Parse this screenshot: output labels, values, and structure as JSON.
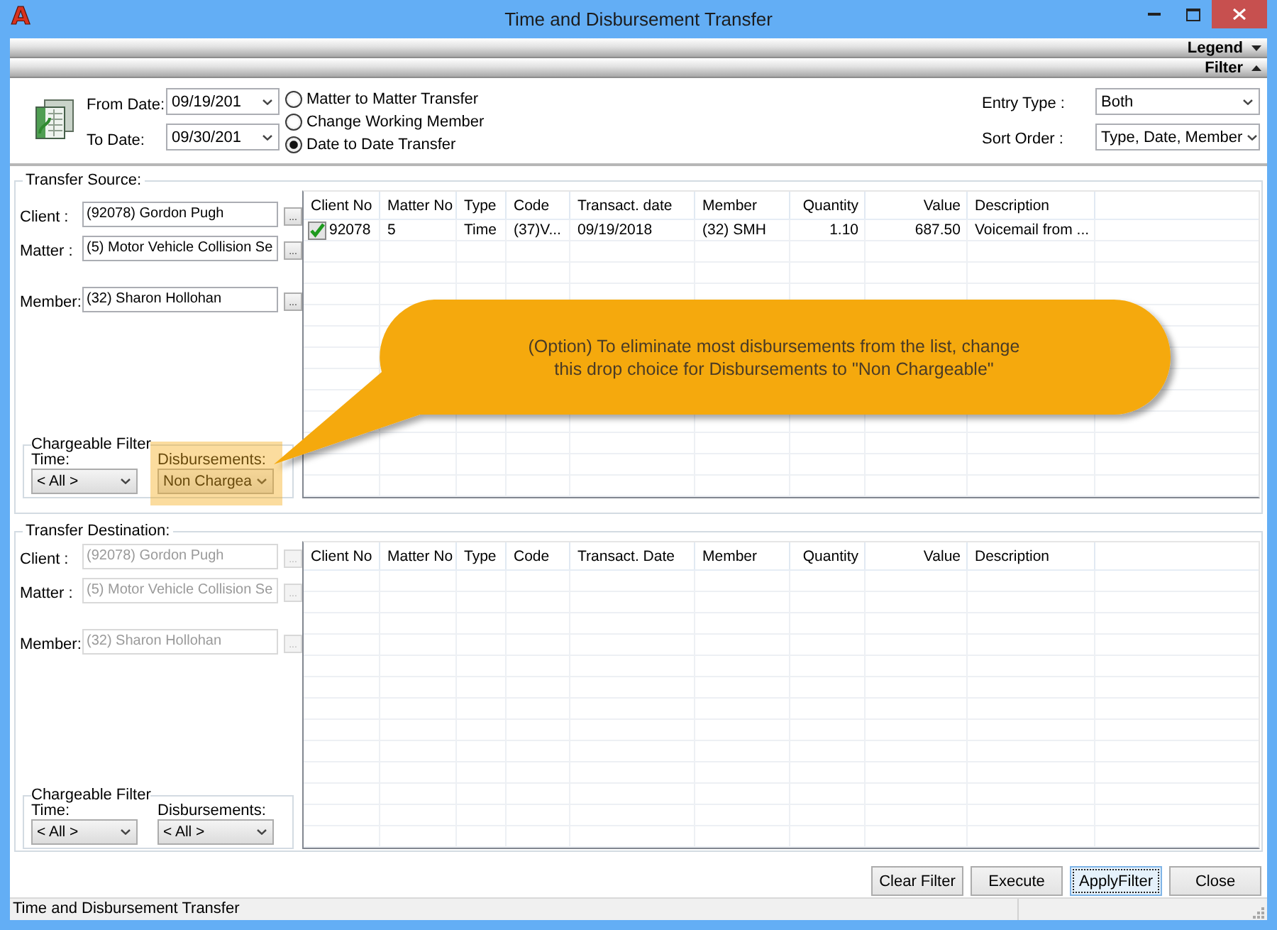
{
  "window": {
    "logo": "A",
    "title": "Time and Disbursement Transfer"
  },
  "panel_bars": [
    {
      "label": "Legend",
      "expanded": false
    },
    {
      "label": "Filter",
      "expanded": true
    }
  ],
  "filter": {
    "from_date": {
      "label": "From Date:",
      "value": "09/19/201"
    },
    "to_date": {
      "label": "To Date:",
      "value": "09/30/201"
    },
    "transfer_modes": [
      {
        "label": "Matter to Matter Transfer",
        "selected": false
      },
      {
        "label": "Change Working Member",
        "selected": false
      },
      {
        "label": "Date to Date Transfer",
        "selected": true
      }
    ],
    "entry_type": {
      "label": "Entry Type :",
      "value": "Both"
    },
    "sort_order": {
      "label": "Sort Order :",
      "value": "Type, Date, Member"
    }
  },
  "sections": [
    {
      "title": "Transfer Source:",
      "fields": [
        {
          "label": "Client :",
          "value": "(92078) Gordon Pugh",
          "button": "...",
          "disabled": false
        },
        {
          "label": "Matter :",
          "value": "(5) Motor Vehicle Collision Se",
          "button": "...",
          "disabled": false
        },
        {
          "label": "Member:",
          "value": "(32) Sharon Hollohan",
          "button": "...",
          "disabled": false
        }
      ],
      "chargeable_filter": {
        "title": "Chargeable Filter",
        "time": {
          "label": "Time:",
          "value": "< All >",
          "highlighted": false
        },
        "disbursements": {
          "label": "Disbursements:",
          "value": "Non Chargea",
          "highlighted": true
        }
      },
      "table": {
        "columns": [
          {
            "label": "Client No",
            "numeric": false
          },
          {
            "label": "Matter No",
            "numeric": false
          },
          {
            "label": "Type",
            "numeric": false
          },
          {
            "label": "Code",
            "numeric": false
          },
          {
            "label": "Transact. date",
            "numeric": false
          },
          {
            "label": "Member",
            "numeric": false
          },
          {
            "label": "Quantity",
            "numeric": true
          },
          {
            "label": "Value",
            "numeric": true
          },
          {
            "label": "Description",
            "numeric": false
          }
        ],
        "rows": [
          {
            "checked": true,
            "cells": [
              "92078",
              "5",
              "Time",
              "(37)V...",
              "09/19/2018",
              "(32) SMH",
              "1.10",
              "687.50",
              "Voicemail from ..."
            ]
          }
        ]
      }
    },
    {
      "title": "Transfer Destination:",
      "fields": [
        {
          "label": "Client :",
          "value": "(92078) Gordon Pugh",
          "button": "...",
          "disabled": true
        },
        {
          "label": "Matter :",
          "value": "(5) Motor Vehicle Collision Se",
          "button": "...",
          "disabled": true
        },
        {
          "label": "Member:",
          "value": "(32) Sharon Hollohan",
          "button": "...",
          "disabled": true
        }
      ],
      "chargeable_filter": {
        "title": "Chargeable Filter",
        "time": {
          "label": "Time:",
          "value": "< All >",
          "highlighted": false
        },
        "disbursements": {
          "label": "Disbursements:",
          "value": "< All >",
          "highlighted": false
        }
      },
      "table": {
        "columns": [
          {
            "label": "Client No",
            "numeric": false
          },
          {
            "label": "Matter No",
            "numeric": false
          },
          {
            "label": "Type",
            "numeric": false
          },
          {
            "label": "Code",
            "numeric": false
          },
          {
            "label": "Transact. Date",
            "numeric": false
          },
          {
            "label": "Member",
            "numeric": false
          },
          {
            "label": "Quantity",
            "numeric": true
          },
          {
            "label": "Value",
            "numeric": true
          },
          {
            "label": "Description",
            "numeric": false
          }
        ]
      }
    }
  ],
  "callout": {
    "lines": [
      "(Option) To eliminate most disbursements from the list, change",
      "this drop choice for Disbursements to \"Non Chargeable\""
    ]
  },
  "buttons": [
    {
      "label": "Clear Filter",
      "focused": false
    },
    {
      "label": "Execute",
      "focused": false
    },
    {
      "label": "ApplyFilter",
      "focused": true
    },
    {
      "label": "Close",
      "focused": false
    }
  ],
  "status_bar": {
    "text": "Time and Disbursement Transfer"
  }
}
